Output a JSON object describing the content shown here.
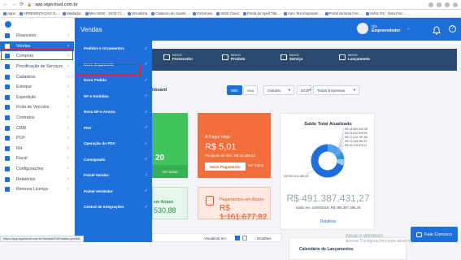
{
  "browser": {
    "url": "app.sigecloud.com.br",
    "status_url": "https://app.sigecloud.com.br/Vendas/Edit?status=pedido",
    "bookmarks": [
      {
        "label": "Apps"
      },
      {
        "label": "APRESENTAÇÃO D..."
      },
      {
        "label": "Validador"
      },
      {
        "label": "Meu SIGE - SIGE Cl..."
      },
      {
        "label": "Moodinha"
      },
      {
        "label": "Cadastro de Usuári..."
      },
      {
        "label": "Portomeis"
      },
      {
        "label": "SIGE Cloud"
      },
      {
        "label": "Portal do Sped Tab..."
      },
      {
        "label": "Auto Text Expander..."
      },
      {
        "label": "Portal da Nota Fisc..."
      },
      {
        "label": "Sefaz RS - Nota Fisc..."
      }
    ]
  },
  "sidebar": {
    "items": [
      {
        "label": "Financeiro",
        "icon": "dollar-icon",
        "active": false
      },
      {
        "label": "Vendas",
        "icon": "cart-icon",
        "active": true
      },
      {
        "label": "Compras",
        "icon": "bag-icon",
        "active": false
      },
      {
        "label": "Precificação de Serviços",
        "icon": "tools-icon",
        "active": false
      },
      {
        "label": "Cadastros",
        "icon": "users-icon",
        "active": false
      },
      {
        "label": "Estoque",
        "icon": "box-icon",
        "active": false
      },
      {
        "label": "Expedição",
        "icon": "truck-icon",
        "active": false
      },
      {
        "label": "Frota de Veículos",
        "icon": "car-icon",
        "active": false
      },
      {
        "label": "Contratos",
        "icon": "contract-icon",
        "active": false
      },
      {
        "label": "CRM",
        "icon": "crm-icon",
        "active": false
      },
      {
        "label": "PCP",
        "icon": "gear-icon",
        "active": false
      },
      {
        "label": "RH",
        "icon": "person-icon",
        "active": false
      },
      {
        "label": "Fiscal",
        "icon": "document-icon",
        "active": false
      },
      {
        "label": "Configurações",
        "icon": "settings-icon",
        "active": false
      },
      {
        "label": "Relatórios",
        "icon": "chart-icon",
        "active": false
      },
      {
        "label": "Renovar Licença",
        "icon": "refresh-icon",
        "active": false
      }
    ]
  },
  "submenu": {
    "title": "Vendas",
    "items": [
      {
        "label": "Pedidos e Orçamentos"
      },
      {
        "label": "Novo Orçamento"
      },
      {
        "label": "Novo Pedido"
      },
      {
        "label": "NF-e Emitidas"
      },
      {
        "label": "Nova NF-e Avulsa"
      },
      {
        "label": "PDV"
      },
      {
        "label": "Operação do PDV"
      },
      {
        "label": "Consignado"
      },
      {
        "label": "Painel Vendas"
      },
      {
        "label": "Painel Vendedor"
      },
      {
        "label": "Central de Integrações"
      }
    ]
  },
  "topbar": {
    "greeting": "Olá",
    "user_name": "Empreendedor"
  },
  "quick_actions": [
    {
      "small": "NOVO",
      "big": "Fornecedor"
    },
    {
      "small": "NOVO",
      "big": "Produto"
    },
    {
      "small": "NOVO",
      "big": "Serviço"
    },
    {
      "small": "NOVO",
      "big": "Lançamento"
    }
  ],
  "dashboard": {
    "title_partial": "hboard",
    "filters": {
      "mes": "Mês",
      "ano": "Ano",
      "month": "Outubro",
      "year": "2019",
      "company": "Todas Empresas"
    }
  },
  "cards": {
    "green": {
      "count": "20",
      "link": "Ver todos"
    },
    "orange": {
      "label": "A Pagar Hoje",
      "amount": "R$ 5,01",
      "sub": "Pendente do mês: R$ 32.369,42",
      "button": "Novo Pagamento",
      "link": "Ver todos"
    },
    "green2": {
      "line1": "em Atraso",
      "line2": "530,88"
    },
    "peach": {
      "line1": "Pagamentos em Atraso",
      "line2": "R$ 1.161.677,82",
      "line3": "Atualizado em 14/10/2019 09:28:00"
    }
  },
  "saldo": {
    "title": "Saldo Total Atualizado",
    "amount": "R$ 491.387.431,27",
    "sub": "Saldo em 14/09/2019: R$ 488.387.396,26",
    "link": "Detalhes",
    "legend": [
      "R$ 18.569.839,38",
      "R$ 23.810.535,65",
      "R$ 27.224.787,86",
      "R$ 21.246.981,57",
      "R$ 28.229.675,11"
    ],
    "big_slice": "R$ 500.101.850,80"
  },
  "bottom": {
    "view_label": "Visualizar em:",
    "details": "Detalhes",
    "calendar_title": "Calendário de Lançamentos"
  },
  "watermark": {
    "line1": "Ativar o Windows",
    "line2": "Acesse Configurações para ativar o Windows."
  },
  "chat": {
    "label": "Fale Conosco"
  }
}
